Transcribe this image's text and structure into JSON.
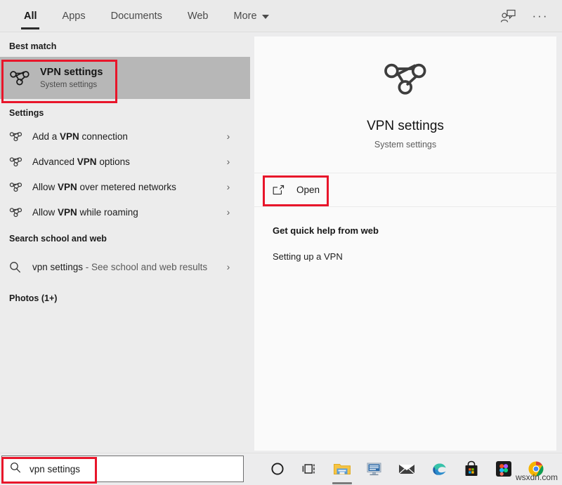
{
  "tabbar": {
    "tabs": [
      {
        "label": "All",
        "active": true
      },
      {
        "label": "Apps",
        "active": false
      },
      {
        "label": "Documents",
        "active": false
      },
      {
        "label": "Web",
        "active": false
      },
      {
        "label": "More",
        "active": false
      }
    ],
    "feedback_icon": "person-feedback-icon",
    "more_icon": "ellipsis-icon"
  },
  "left": {
    "best_match_heading": "Best match",
    "best_match": {
      "title": "VPN settings",
      "subtitle": "System settings",
      "icon": "vpn-icon"
    },
    "settings_heading": "Settings",
    "settings_items": [
      {
        "pre": "Add a ",
        "bold": "VPN",
        "post": " connection",
        "icon": "vpn-icon",
        "chevron": "›"
      },
      {
        "pre": "Advanced ",
        "bold": "VPN",
        "post": " options",
        "icon": "vpn-icon",
        "chevron": "›"
      },
      {
        "pre": "Allow ",
        "bold": "VPN",
        "post": " over metered networks",
        "icon": "vpn-icon",
        "chevron": "›"
      },
      {
        "pre": "Allow ",
        "bold": "VPN",
        "post": " while roaming",
        "icon": "vpn-icon",
        "chevron": "›"
      }
    ],
    "web_heading": "Search school and web",
    "web_item": {
      "query": "vpn settings",
      "description": " - See school and web results",
      "icon": "search-icon",
      "chevron": "›"
    },
    "photos_heading": "Photos (1+)"
  },
  "preview": {
    "icon": "vpn-icon",
    "title": "VPN settings",
    "subtitle": "System settings",
    "open_label": "Open",
    "open_icon": "open-external-icon",
    "help_title": "Get quick help from web",
    "help_link": "Setting up a VPN"
  },
  "taskbar": {
    "search": {
      "value": "vpn settings",
      "icon": "search-icon"
    },
    "items": [
      {
        "name": "cortana-icon",
        "label": "Cortana"
      },
      {
        "name": "task-view-icon",
        "label": "Task View"
      },
      {
        "name": "file-explorer-icon",
        "label": "File Explorer"
      },
      {
        "name": "media-player-icon",
        "label": "Media Player"
      },
      {
        "name": "mail-icon",
        "label": "Mail"
      },
      {
        "name": "edge-icon",
        "label": "Microsoft Edge"
      },
      {
        "name": "microsoft-store-icon",
        "label": "Microsoft Store"
      },
      {
        "name": "figma-icon",
        "label": "Figma"
      },
      {
        "name": "chrome-icon",
        "label": "Google Chrome"
      }
    ],
    "watermark": "wsxdn.com"
  },
  "annotations": {
    "color": "#e8152a",
    "boxes": [
      "best-match-highlight",
      "open-button-highlight",
      "search-box-highlight"
    ]
  }
}
